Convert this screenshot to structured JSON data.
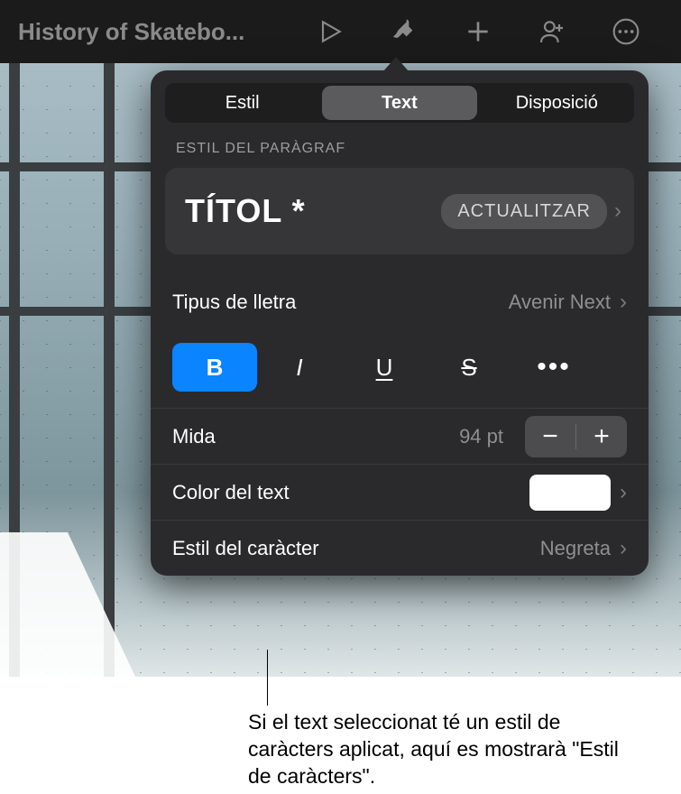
{
  "toolbar": {
    "doc_title": "History of Skatebo..."
  },
  "popover": {
    "tabs": {
      "style": "Estil",
      "text": "Text",
      "layout": "Disposició"
    },
    "section_label": "ESTIL DEL PARÀGRAF",
    "para_title": "TÍTOL *",
    "update_label": "ACTUALITZAR",
    "font": {
      "label": "Tipus de lletra",
      "value": "Avenir Next"
    },
    "buttons": {
      "bold": "B",
      "italic": "I",
      "underline": "U",
      "strike": "S",
      "more": "•••"
    },
    "size": {
      "label": "Mida",
      "value": "94 pt"
    },
    "color": {
      "label": "Color del text",
      "value": "#ffffff"
    },
    "char_style": {
      "label": "Estil del caràcter",
      "value": "Negreta"
    }
  },
  "callout": "Si el text seleccionat té un estil de caràcters aplicat, aquí es mostrarà \"Estil de caràcters\"."
}
